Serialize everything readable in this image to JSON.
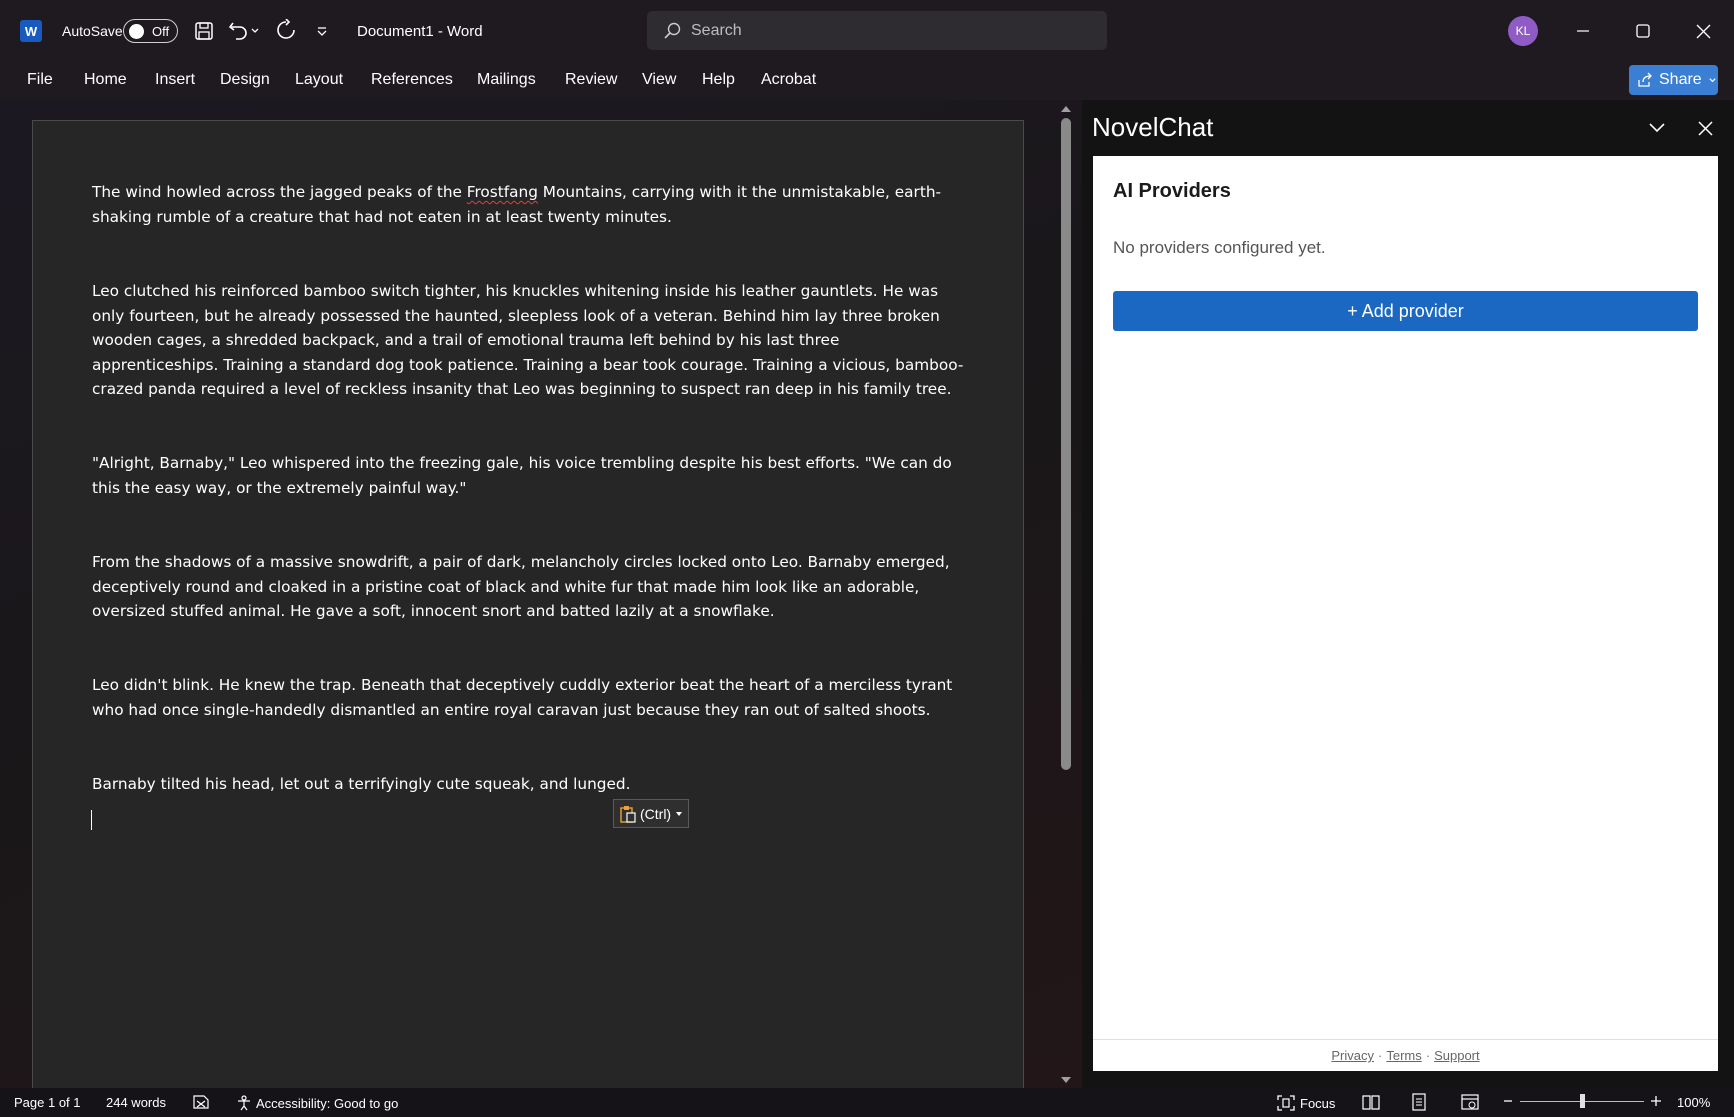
{
  "titlebar": {
    "autosave_label": "AutoSave",
    "autosave_state": "Off",
    "document_title": "Document1  -  Word",
    "search_placeholder": "Search",
    "avatar_initials": "KL",
    "app_logo_letter": "W"
  },
  "menu": {
    "items": [
      "File",
      "Home",
      "Insert",
      "Design",
      "Layout",
      "References",
      "Mailings",
      "Review",
      "View",
      "Help",
      "Acrobat"
    ],
    "share_label": "Share"
  },
  "document": {
    "paragraphs": [
      "The wind howled across the jagged peaks of the Frostfang Mountains, carrying with it the unmistakable, earth-shaking rumble of a creature that had not eaten in at least twenty minutes.",
      "Leo clutched his reinforced bamboo switch tighter, his knuckles whitening inside his leather gauntlets. He was only fourteen, but he already possessed the haunted, sleepless look of a veteran. Behind him lay three broken wooden cages, a shredded backpack, and a trail of emotional trauma left behind by his last three apprenticeships. Training a standard dog took patience. Training a bear took courage. Training a vicious, bamboo-crazed panda required a level of reckless insanity that Leo was beginning to suspect ran deep in his family tree.",
      "\"Alright, Barnaby,\" Leo whispered into the freezing gale, his voice trembling despite his best efforts. \"We can do this the easy way, or the extremely painful way.\"",
      "From the shadows of a massive snowdrift, a pair of dark, melancholy circles locked onto Leo. Barnaby emerged, deceptively round and cloaked in a pristine coat of black and white fur that made him look like an adorable, oversized stuffed animal. He gave a soft, innocent snort and batted lazily at a snowflake.",
      "Leo didn't blink. He knew the trap. Beneath that deceptively cuddly exterior beat the heart of a merciless tyrant who had once single-handedly dismantled an entire royal caravan just because they ran out of salted shoots.",
      "Barnaby tilted his head, let out a terrifyingly cute squeak, and lunged."
    ],
    "p1_before": "The wind howled across the jagged peaks of the ",
    "p1_misspelled": "Frostfang",
    "p1_after": " Mountains, carrying with it the unmistakable, earth-shaking rumble of a creature that had not eaten in at least twenty minutes.",
    "paste_options_label": "(Ctrl)"
  },
  "pane": {
    "title": "NovelChat",
    "heading": "AI Providers",
    "empty_text": "No providers configured yet.",
    "add_button": "+ Add provider",
    "footer": {
      "privacy": "Privacy",
      "terms": "Terms",
      "support": "Support",
      "separator": "·"
    }
  },
  "status": {
    "page": "Page 1 of 1",
    "words": "244 words",
    "accessibility": "Accessibility: Good to go",
    "focus": "Focus",
    "zoom": "100%"
  },
  "icons": {
    "logo": "word-logo-icon",
    "save": "save-icon",
    "undo": "undo-icon",
    "redo": "redo-icon",
    "customize": "customize-qat-icon",
    "search": "search-icon",
    "minimize": "minimize-icon",
    "maximize": "maximize-icon",
    "close": "close-icon"
  },
  "colors": {
    "accent": "#1b68c2",
    "share": "#3b7fd4",
    "avatar": "#8e5cc4"
  }
}
